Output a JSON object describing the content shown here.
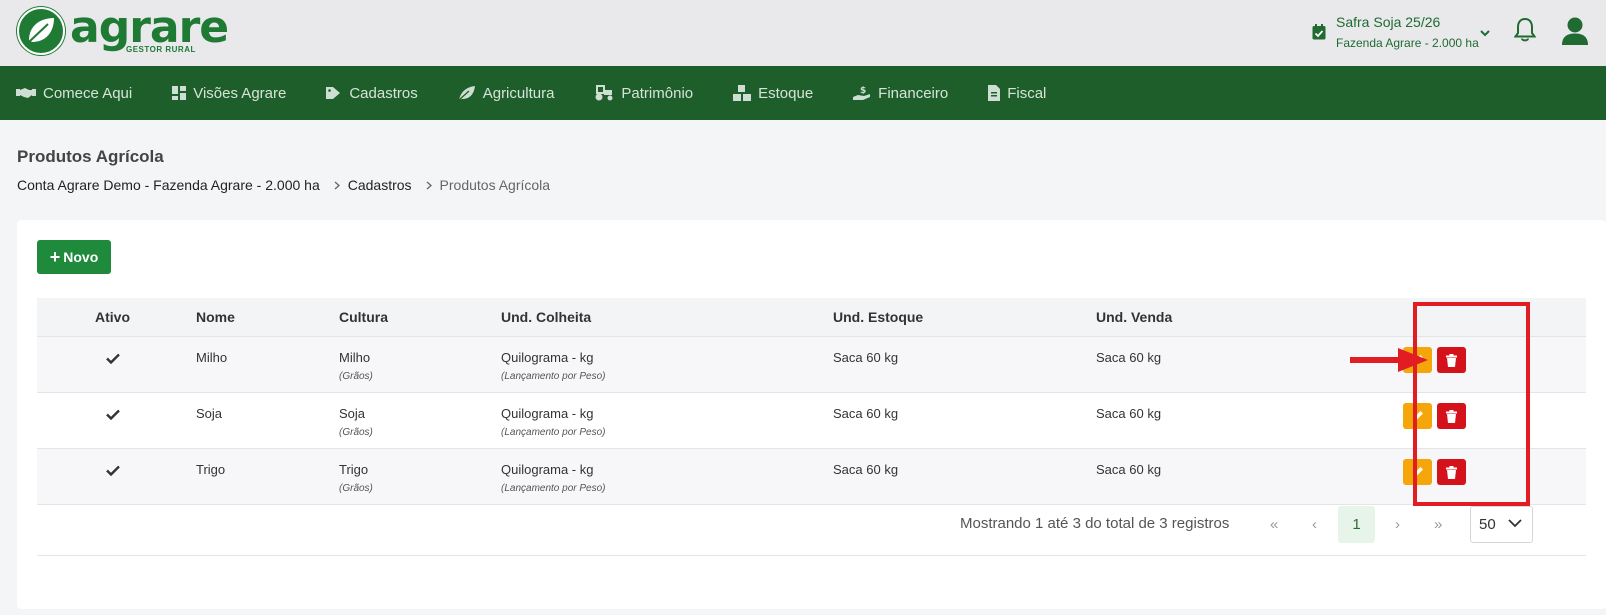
{
  "brand": {
    "name": "agrare",
    "subtitle": "GESTOR RURAL",
    "color": "#1f7a34"
  },
  "header": {
    "safra_title": "Safra Soja 25/26",
    "safra_subtitle": "Fazenda Agrare - 2.000 ha",
    "icons": [
      "calendar-check-icon",
      "chevron-down-icon",
      "bell-icon",
      "user-icon"
    ]
  },
  "nav": {
    "items": [
      {
        "label": "Comece Aqui",
        "icon": "handshake-icon"
      },
      {
        "label": "Visões Agrare",
        "icon": "dashboard-icon"
      },
      {
        "label": "Cadastros",
        "icon": "tag-icon"
      },
      {
        "label": "Agricultura",
        "icon": "leaf-icon"
      },
      {
        "label": "Patrimônio",
        "icon": "tractor-icon"
      },
      {
        "label": "Estoque",
        "icon": "boxes-icon"
      },
      {
        "label": "Financeiro",
        "icon": "hand-money-icon"
      },
      {
        "label": "Fiscal",
        "icon": "file-invoice-icon"
      }
    ],
    "background": "#1e5e2a"
  },
  "page": {
    "title": "Produtos Agrícola",
    "breadcrumb": [
      "Conta Agrare Demo - Fazenda Agrare - 2.000 ha",
      "Cadastros",
      "Produtos Agrícola"
    ]
  },
  "toolbar": {
    "new_label": "Novo"
  },
  "table": {
    "headers": [
      "Ativo",
      "Nome",
      "Cultura",
      "Und. Colheita",
      "Und. Estoque",
      "Und. Venda"
    ],
    "rows": [
      {
        "ativo": true,
        "nome": "Milho",
        "cultura": "Milho",
        "cultura_sub": "(Grãos)",
        "colheita": "Quilograma - kg",
        "colheita_sub": "(Lançamento por Peso)",
        "estoque": "Saca 60 kg",
        "venda": "Saca 60 kg"
      },
      {
        "ativo": true,
        "nome": "Soja",
        "cultura": "Soja",
        "cultura_sub": "(Grãos)",
        "colheita": "Quilograma - kg",
        "colheita_sub": "(Lançamento por Peso)",
        "estoque": "Saca 60 kg",
        "venda": "Saca 60 kg"
      },
      {
        "ativo": true,
        "nome": "Trigo",
        "cultura": "Trigo",
        "cultura_sub": "(Grãos)",
        "colheita": "Quilograma - kg",
        "colheita_sub": "(Lançamento por Peso)",
        "estoque": "Saca 60 kg",
        "venda": "Saca 60 kg"
      }
    ],
    "colors": {
      "edit": "#f5a60a",
      "delete": "#d4121b"
    }
  },
  "pagination": {
    "info": "Mostrando 1 até 3 do total de 3 registros",
    "first": "«",
    "prev": "‹",
    "current_page": "1",
    "next": "›",
    "last": "»",
    "page_size": "50"
  },
  "annotation": {
    "color": "#e11c22"
  }
}
